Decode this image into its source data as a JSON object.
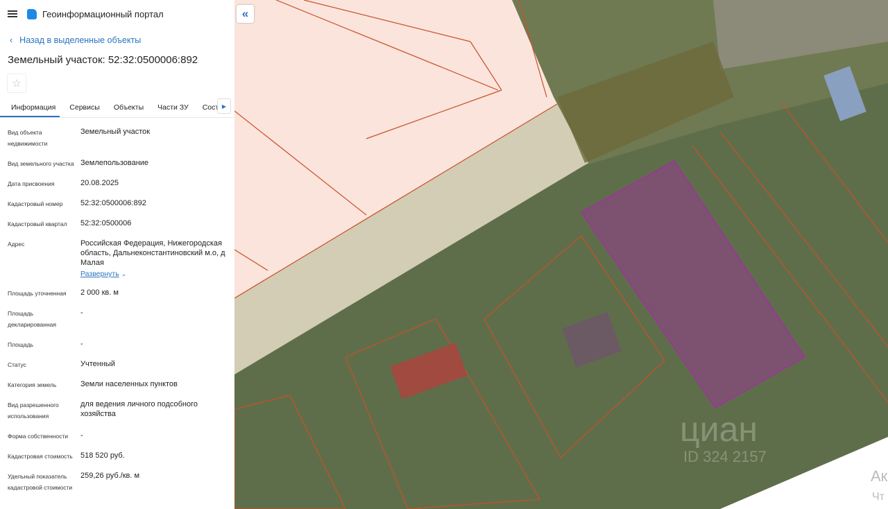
{
  "header": {
    "app_title": "Геоинформационный портал"
  },
  "nav": {
    "back_label": "Назад в выделенные объекты"
  },
  "object": {
    "title": "Земельный участок: 52:32:0500006:892"
  },
  "tabs": [
    {
      "label": "Информация",
      "active": true
    },
    {
      "label": "Сервисы"
    },
    {
      "label": "Объекты"
    },
    {
      "label": "Части ЗУ"
    },
    {
      "label": "Состав"
    }
  ],
  "fields": [
    {
      "label": "Вид объекта недвижимости",
      "value": "Земельный участок"
    },
    {
      "label": "Вид земельного участка",
      "value": "Землепользование"
    },
    {
      "label": "Дата присвоения",
      "value": "20.08.2025"
    },
    {
      "label": "Кадастровый номер",
      "value": "52:32:0500006:892"
    },
    {
      "label": "Кадастровый квартал",
      "value": "52:32:0500006"
    },
    {
      "label": "Адрес",
      "value": "Российская Федерация, Нижегородская область, Дальнеконстантиновский м.о, д Малая",
      "link": "Развернуть"
    },
    {
      "label": "Площадь уточненная",
      "value": "2 000 кв. м"
    },
    {
      "label": "Площадь декларированная",
      "value": "-"
    },
    {
      "label": "Площадь",
      "value": "-"
    },
    {
      "label": "Статус",
      "value": "Учтенный"
    },
    {
      "label": "Категория земель",
      "value": "Земли населенных пунктов"
    },
    {
      "label": "Вид разрешенного использования",
      "value": "для ведения личного подсобного хозяйства"
    },
    {
      "label": "Форма собственности",
      "value": "-"
    },
    {
      "label": "Кадастровая стоимость",
      "value": "518 520 руб."
    },
    {
      "label": "Удельный показатель кадастровой стоимости",
      "value": "259,26 руб./кв. м"
    }
  ],
  "map": {
    "collapse_icon": "«",
    "watermark": "циан",
    "watermark_id": "ID 324 2157",
    "corner_text_1": "Ак",
    "corner_text_2": "Чт",
    "selected_color": "#a030a0",
    "parcel_color": "#c8502a"
  }
}
